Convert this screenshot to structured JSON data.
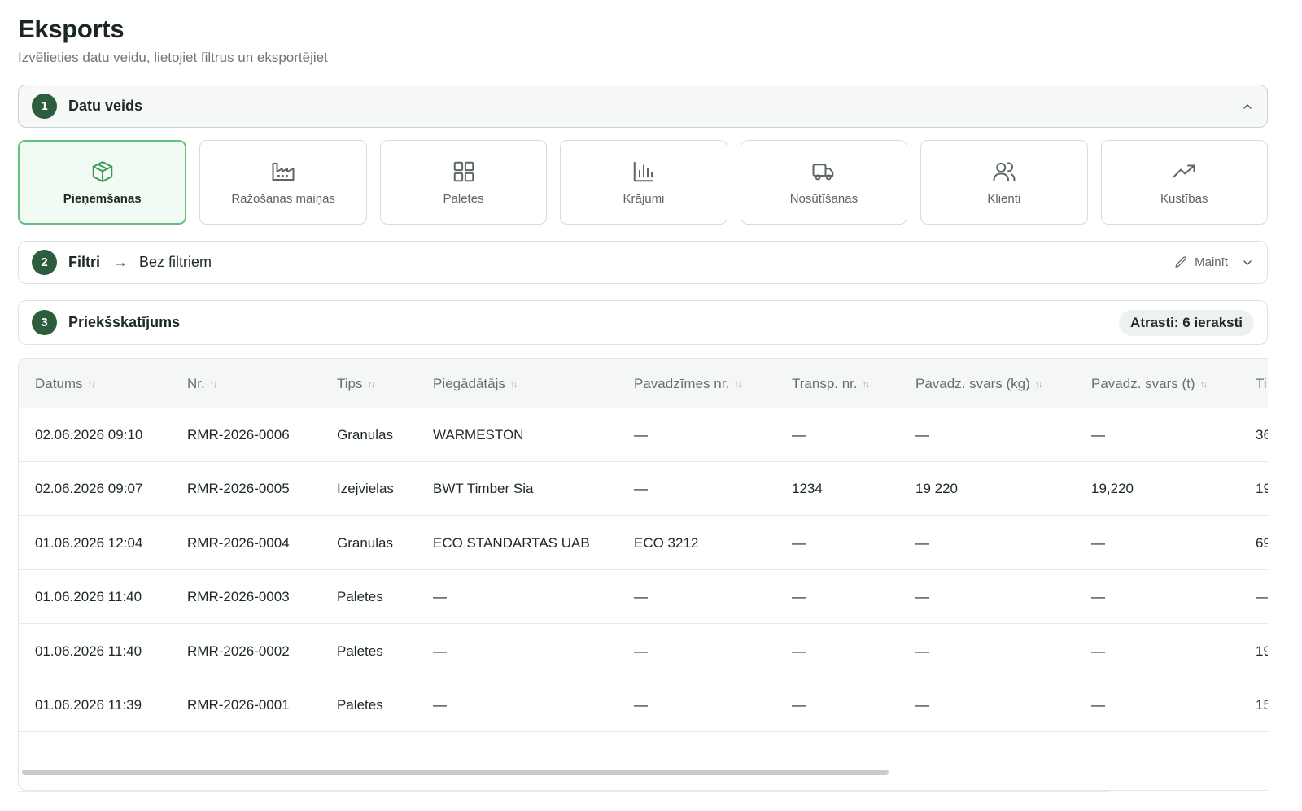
{
  "header": {
    "title": "Eksports",
    "subtitle": "Izvēlieties datu veidu, lietojiet filtrus un eksportējiet"
  },
  "step1": {
    "number": "1",
    "title": "Datu veids"
  },
  "data_types": [
    {
      "label": "Pieņemšanas",
      "icon": "package-icon",
      "active": true
    },
    {
      "label": "Ražošanas maiņas",
      "icon": "factory-icon",
      "active": false
    },
    {
      "label": "Paletes",
      "icon": "grid-icon",
      "active": false
    },
    {
      "label": "Krājumi",
      "icon": "bar-chart-icon",
      "active": false
    },
    {
      "label": "Nosūtīšanas",
      "icon": "truck-icon",
      "active": false
    },
    {
      "label": "Klienti",
      "icon": "users-icon",
      "active": false
    },
    {
      "label": "Kustības",
      "icon": "trending-up-icon",
      "active": false
    }
  ],
  "step2": {
    "number": "2",
    "title": "Filtri",
    "value": "Bez filtriem",
    "edit_label": "Mainīt"
  },
  "step3": {
    "number": "3",
    "title": "Priekšskatījums",
    "count_label": "Atrasti: 6 ieraksti"
  },
  "table": {
    "columns": [
      "Datums",
      "Nr.",
      "Tips",
      "Piegādātājs",
      "Pavadzīmes nr.",
      "Transp. nr.",
      "Pavadz. svars (kg)",
      "Pavadz. svars (t)",
      "Ti"
    ],
    "rows": [
      [
        "02.06.2026 09:10",
        "RMR-2026-0006",
        "Granulas",
        "WARMESTON",
        "—",
        "—",
        "—",
        "—",
        "36"
      ],
      [
        "02.06.2026 09:07",
        "RMR-2026-0005",
        "Izejvielas",
        "BWT Timber Sia",
        "—",
        "1234",
        "19 220",
        "19,220",
        "19"
      ],
      [
        "01.06.2026 12:04",
        "RMR-2026-0004",
        "Granulas",
        "ECO STANDARTAS UAB",
        "ECO 3212",
        "—",
        "—",
        "—",
        "69"
      ],
      [
        "01.06.2026 11:40",
        "RMR-2026-0003",
        "Paletes",
        "—",
        "—",
        "—",
        "—",
        "—",
        "—"
      ],
      [
        "01.06.2026 11:40",
        "RMR-2026-0002",
        "Paletes",
        "—",
        "—",
        "—",
        "—",
        "—",
        "19"
      ],
      [
        "01.06.2026 11:39",
        "RMR-2026-0001",
        "Paletes",
        "—",
        "—",
        "—",
        "—",
        "—",
        "15"
      ]
    ]
  }
}
